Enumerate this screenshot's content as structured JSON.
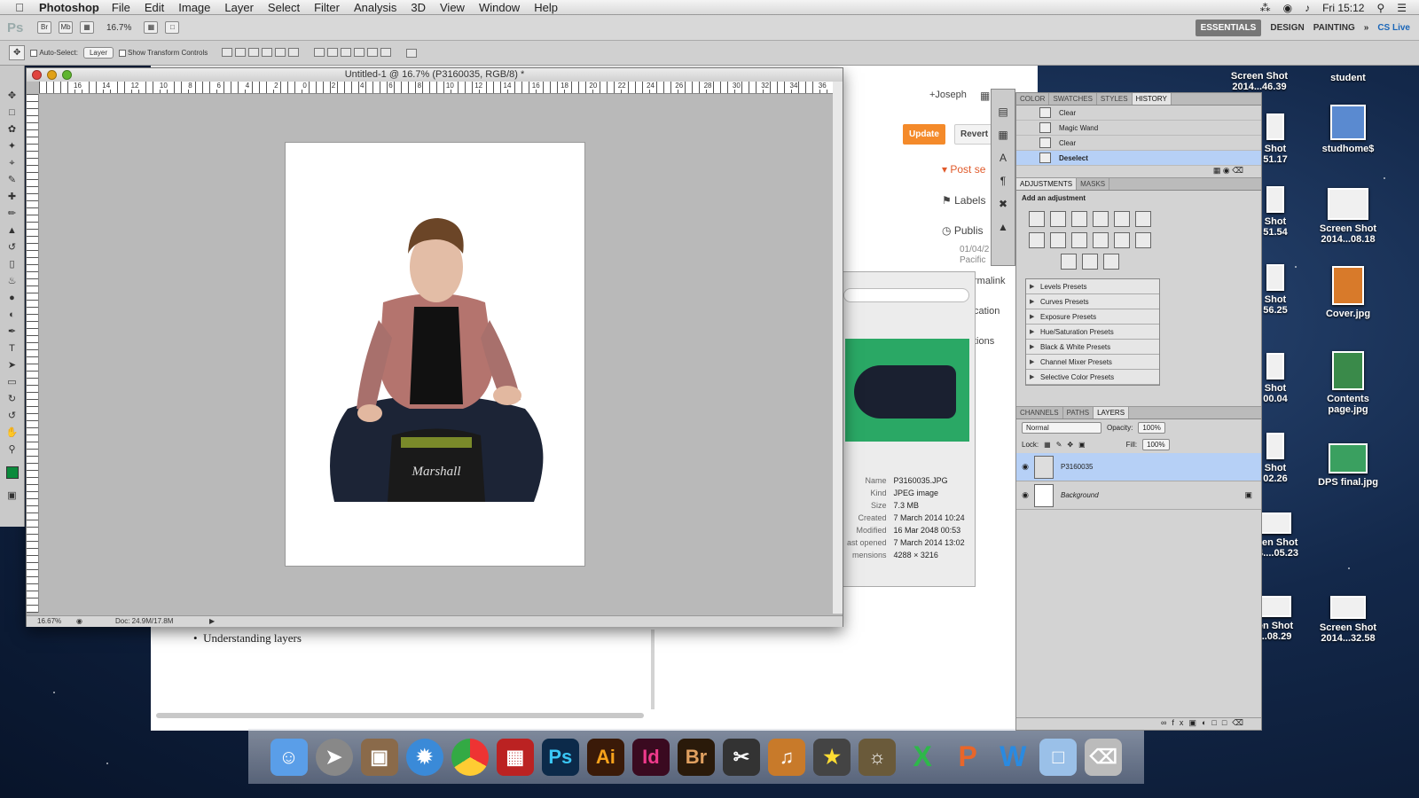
{
  "menubar": {
    "app_name": "Photoshop",
    "items": [
      "File",
      "Edit",
      "Image",
      "Layer",
      "Select",
      "Filter",
      "Analysis",
      "3D",
      "View",
      "Window",
      "Help"
    ],
    "clock": "Fri 15:12"
  },
  "optbar": {
    "ps_logo": "Ps",
    "zoom": "16.7%",
    "workspaces": [
      "ESSENTIALS",
      "DESIGN",
      "PAINTING"
    ],
    "cs_live": "CS Live"
  },
  "tool_options": {
    "auto_select": "Auto-Select:",
    "auto_select_value": "Layer",
    "show_transform": "Show Transform Controls"
  },
  "doc": {
    "title": "Untitled-1 @ 16.7% (P3160035, RGB/8) *",
    "ruler_labels": [
      "16",
      "14",
      "12",
      "10",
      "8",
      "6",
      "4",
      "2",
      "0",
      "2",
      "4",
      "6",
      "8",
      "10",
      "12",
      "14",
      "16",
      "18",
      "20",
      "22",
      "24",
      "26",
      "28",
      "30",
      "32",
      "34",
      "36"
    ],
    "status_zoom": "16.67%",
    "status_doc": "Doc: 24.9M/17.8M"
  },
  "browser": {
    "bullet": "Understanding layers"
  },
  "blogger": {
    "user": "+Joseph",
    "update": "Update",
    "revert": "Revert",
    "post_settings": "Post se",
    "labels": "Labels",
    "publish": "Publis",
    "publish_date": "01/04/2",
    "publish_tz": "Pacific",
    "permalink": "rmalink",
    "location": "cation",
    "options": "tions"
  },
  "finder": {
    "info": [
      {
        "k": "Name",
        "v": "P3160035.JPG"
      },
      {
        "k": "Kind",
        "v": "JPEG image"
      },
      {
        "k": "Size",
        "v": "7.3 MB"
      },
      {
        "k": "Created",
        "v": "7 March 2014 10:24"
      },
      {
        "k": "Modified",
        "v": "16 Mar 2048 00:53"
      },
      {
        "k": "ast opened",
        "v": "7 March 2014 13:02"
      },
      {
        "k": "mensions",
        "v": "4288 × 3216"
      }
    ]
  },
  "panels": {
    "top_tabs": [
      "COLOR",
      "SWATCHES",
      "STYLES",
      "HISTORY"
    ],
    "history": [
      "Clear",
      "Magic Wand",
      "Clear",
      "Deselect"
    ],
    "adj_tabs": [
      "ADJUSTMENTS",
      "MASKS"
    ],
    "adj_title": "Add an adjustment",
    "presets": [
      "Levels Presets",
      "Curves Presets",
      "Exposure Presets",
      "Hue/Saturation Presets",
      "Black & White Presets",
      "Channel Mixer Presets",
      "Selective Color Presets"
    ],
    "layer_tabs": [
      "CHANNELS",
      "PATHS",
      "LAYERS"
    ],
    "blend_mode": "Normal",
    "opacity_label": "Opacity:",
    "opacity": "100%",
    "lock_label": "Lock:",
    "fill_label": "Fill:",
    "fill": "100%",
    "layers": [
      "P3160035",
      "Background"
    ]
  },
  "desktop": {
    "icons": [
      {
        "label": "Screen Shot\n2014...46.39"
      },
      {
        "label": "student"
      },
      {
        "label": "Shot\n51.17"
      },
      {
        "label": "studhome$"
      },
      {
        "label": "Shot\n51.54"
      },
      {
        "label": "Screen Shot\n2014...08.18"
      },
      {
        "label": "Shot\n56.25"
      },
      {
        "label": "Cover.jpg"
      },
      {
        "label": "Shot\n00.04"
      },
      {
        "label": "Contents\npage.jpg"
      },
      {
        "label": "Shot\n02.26"
      },
      {
        "label": "DPS final.jpg"
      },
      {
        "label": "reen Shot\n14....05.23"
      },
      {
        "label": "en Shot\n...08.29"
      },
      {
        "label": "Screen Shot\n2014...32.58"
      }
    ]
  },
  "dock": {
    "apps": [
      "Finder",
      "Launchpad",
      "Preview",
      "Safari",
      "Chrome",
      "Photo Booth",
      "Ps",
      "Ai",
      "Id",
      "Br",
      "Final Cut",
      "GarageBand",
      "iMovie",
      "iPhoto",
      "X",
      "P",
      "W",
      "Documents",
      "Trash"
    ]
  },
  "colors": {
    "foreground": "#0b8a3c",
    "selection": "#b6d0f6",
    "update_button": "#f48a2a"
  }
}
